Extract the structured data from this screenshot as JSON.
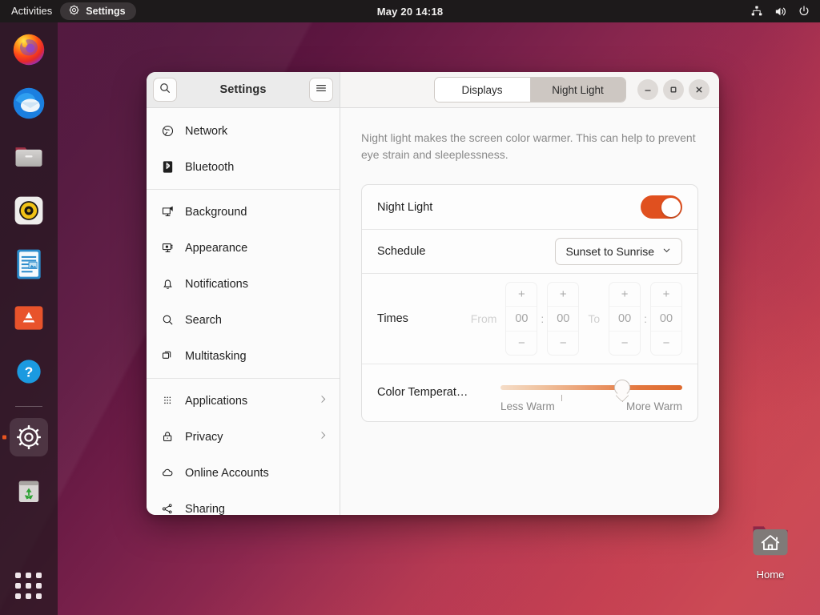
{
  "topbar": {
    "activities": "Activities",
    "app_name": "Settings",
    "app_icon": "gear-icon",
    "clock": "May 20  14:18",
    "status_icons": [
      "network-wired-icon",
      "volume-icon",
      "power-icon"
    ]
  },
  "dock": {
    "items": [
      {
        "name": "firefox",
        "label": "Firefox",
        "running": false
      },
      {
        "name": "thunderbird",
        "label": "Thunderbird",
        "running": false
      },
      {
        "name": "files",
        "label": "Files",
        "running": false
      },
      {
        "name": "rhythmbox",
        "label": "Rhythmbox",
        "running": false
      },
      {
        "name": "libreoffice-writer",
        "label": "LibreOffice Writer",
        "running": false
      },
      {
        "name": "ubuntu-software",
        "label": "Ubuntu Software",
        "running": false
      },
      {
        "name": "help",
        "label": "Help",
        "running": false
      },
      {
        "name": "settings",
        "label": "Settings",
        "running": true
      },
      {
        "name": "trash",
        "label": "Trash",
        "running": false
      }
    ],
    "show_apps_label": "Show Applications"
  },
  "desktop": {
    "home_icon_label": "Home"
  },
  "window": {
    "title": "Settings",
    "search_icon": "search-icon",
    "menu_icon": "hamburger-menu-icon",
    "tabs": [
      {
        "label": "Displays",
        "active": false
      },
      {
        "label": "Night Light",
        "active": true
      }
    ],
    "controls": {
      "minimize": "–",
      "maximize": "□",
      "close": "×"
    }
  },
  "sidebar": {
    "items": [
      {
        "label": "Network",
        "icon": "globe-icon",
        "chevron": false
      },
      {
        "label": "Bluetooth",
        "icon": "bluetooth-icon",
        "chevron": false
      },
      {
        "label": "Background",
        "icon": "monitor-icon",
        "chevron": false
      },
      {
        "label": "Appearance",
        "icon": "appearance-icon",
        "chevron": false
      },
      {
        "label": "Notifications",
        "icon": "bell-icon",
        "chevron": false
      },
      {
        "label": "Search",
        "icon": "search-icon",
        "chevron": false
      },
      {
        "label": "Multitasking",
        "icon": "windows-icon",
        "chevron": false
      },
      {
        "label": "Applications",
        "icon": "grid-dots-icon",
        "chevron": true
      },
      {
        "label": "Privacy",
        "icon": "lock-icon",
        "chevron": true
      },
      {
        "label": "Online Accounts",
        "icon": "cloud-icon",
        "chevron": false
      },
      {
        "label": "Sharing",
        "icon": "share-icon",
        "chevron": false
      }
    ]
  },
  "main": {
    "description": "Night light makes the screen color warmer. This can help to prevent eye strain and sleeplessness.",
    "night_light": {
      "label": "Night Light",
      "enabled": true,
      "accent_color": "#e0501f"
    },
    "schedule": {
      "label": "Schedule",
      "value": "Sunset to Sunrise",
      "chevron_icon": "chevron-down-icon"
    },
    "times": {
      "label": "Times",
      "from_label": "From",
      "to_label": "To",
      "separator": ":",
      "plus": "+",
      "minus": "−",
      "from_hours": "00",
      "from_minutes": "00",
      "to_hours": "00",
      "to_minutes": "00",
      "enabled": false
    },
    "color_temperature": {
      "label": "Color Temperat…",
      "min_label": "Less Warm",
      "max_label": "More Warm",
      "value_percent": 67
    }
  }
}
